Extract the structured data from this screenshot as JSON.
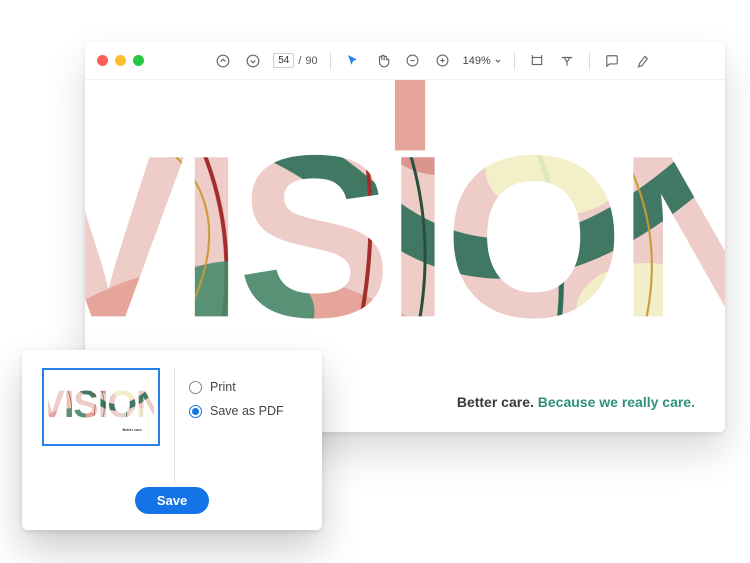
{
  "toolbar": {
    "page_current": "54",
    "page_sep": "/",
    "page_total": "90",
    "zoom_label": "149%"
  },
  "document": {
    "word": "VISION",
    "tagline_part1": "Better care.",
    "tagline_part2": "Because we really care."
  },
  "dialog": {
    "option_print": "Print",
    "option_save_pdf": "Save as PDF",
    "save_button": "Save"
  },
  "colors": {
    "accent_blue": "#1473e6",
    "accent_green": "#2f917b"
  }
}
